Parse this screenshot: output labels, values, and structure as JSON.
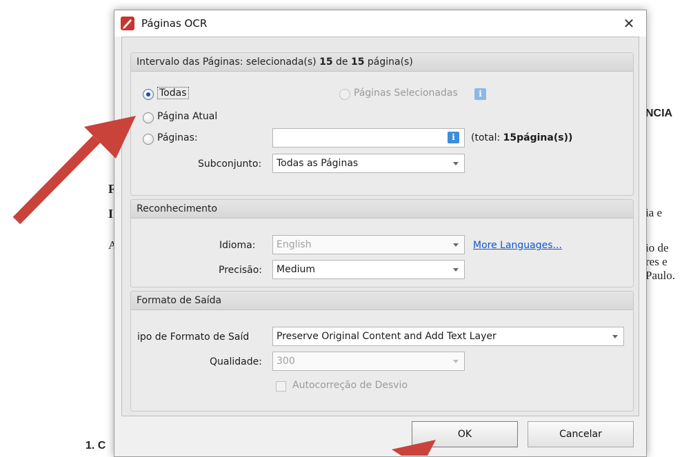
{
  "background_doc": {
    "nc_text": "NCIA",
    "ia_text": "ia   e",
    "io_text": "io de",
    "es_text": "res  e",
    "aulo_text": "Paulo.",
    "left_f": "F",
    "left_i": "I",
    "left_a": "A",
    "bottom_item": "1.  C"
  },
  "dialog": {
    "title": "Páginas OCR",
    "close_glyph": "✕",
    "page_range": {
      "header_prefix": "Intervalo das Páginas: selecionada(s) ",
      "header_selected": "15",
      "header_mid": " de ",
      "header_total": "15",
      "header_suffix": " página(s)",
      "all_label": "Todas",
      "selected_pages_label": "Páginas Selecionadas",
      "current_page_label": "Página Atual",
      "pages_label": "Páginas:",
      "pages_value": "",
      "total_prefix": "(total: ",
      "total_value": "15página(s))",
      "subset_label": "Subconjunto:",
      "subset_value": "Todas as Páginas"
    },
    "recognition": {
      "header": "Reconhecimento",
      "language_label": "Idioma:",
      "language_value": "English",
      "more_languages": "More Languages...",
      "precision_label": "Precisão:",
      "precision_value": "Medium"
    },
    "output": {
      "header": "Formato de Saída",
      "format_type_label": "ipo de Formato de Saíd",
      "format_type_value": "Preserve Original Content and Add Text Layer",
      "quality_label": "Qualidade:",
      "quality_value": "300",
      "deskew_label": "Autocorreção de Desvio"
    },
    "ok_label": "OK",
    "cancel_label": "Cancelar"
  },
  "colors": {
    "annotation_arrow": "#c9433b",
    "info_icon": "#3c8ed8",
    "link": "#1155cc"
  },
  "icons": [
    "app-logo-icon",
    "close-icon",
    "info-icon",
    "chevron-down-icon",
    "annotation-arrow"
  ]
}
